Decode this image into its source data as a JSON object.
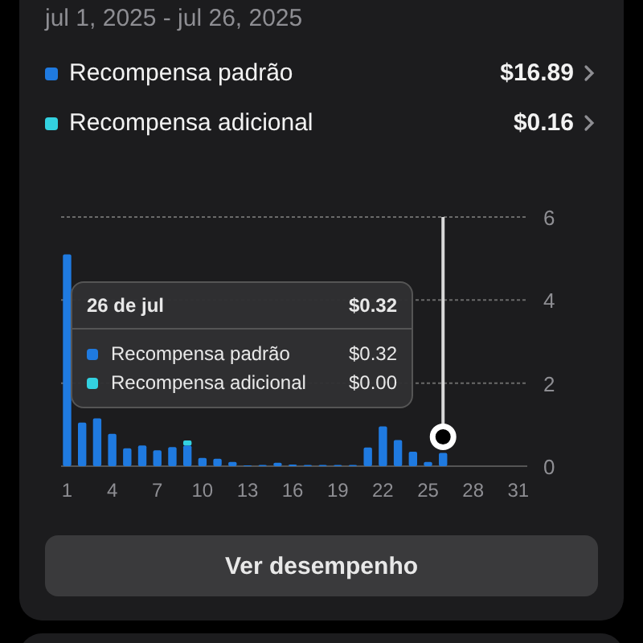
{
  "date_range": "jul 1, 2025 - jul 26, 2025",
  "legend": [
    {
      "amount": "$16.89"
    },
    {
      "amount": "$0.16"
    }
  ],
  "chart": {
    "chart_data": {
      "type": "bar",
      "stacked": true,
      "x": [
        1,
        2,
        3,
        4,
        5,
        6,
        7,
        8,
        9,
        10,
        11,
        12,
        13,
        14,
        15,
        16,
        17,
        18,
        19,
        20,
        21,
        22,
        23,
        24,
        25,
        26
      ],
      "series": [
        {
          "name": "Recompensa padrão",
          "color": "#1f7ae0",
          "values": [
            5.1,
            1.05,
            1.15,
            0.78,
            0.43,
            0.5,
            0.38,
            0.46,
            0.5,
            0.2,
            0.18,
            0.1,
            0.02,
            0.03,
            0.08,
            0.04,
            0.03,
            0.03,
            0.03,
            0.03,
            0.45,
            0.96,
            0.63,
            0.35,
            0.1,
            0.32
          ]
        },
        {
          "name": "Recompensa adicional",
          "color": "#33d1e0",
          "values": [
            0,
            0,
            0,
            0,
            0,
            0,
            0,
            0,
            0.12,
            0,
            0,
            0,
            0,
            0,
            0,
            0,
            0,
            0,
            0,
            0,
            0,
            0,
            0,
            0,
            0,
            0
          ]
        }
      ],
      "xlim": [
        0.6,
        31.6
      ],
      "ylim": [
        0,
        6
      ],
      "yticks": [
        0,
        2,
        4,
        6
      ],
      "xticks": [
        1,
        4,
        7,
        10,
        13,
        16,
        19,
        22,
        25,
        28,
        31
      ],
      "ref_lines": [
        {
          "axis": "x",
          "value": 26
        }
      ]
    },
    "tooltip": {
      "title": "26 de jul",
      "total": "$0.32",
      "rows": [
        {
          "label": "Recompensa padrão",
          "value": "$0.32",
          "color": "#1f7ae0"
        },
        {
          "label": "Recompensa adicional",
          "value": "$0.00",
          "color": "#33d1e0"
        }
      ]
    }
  },
  "button": "Ver desempenho"
}
